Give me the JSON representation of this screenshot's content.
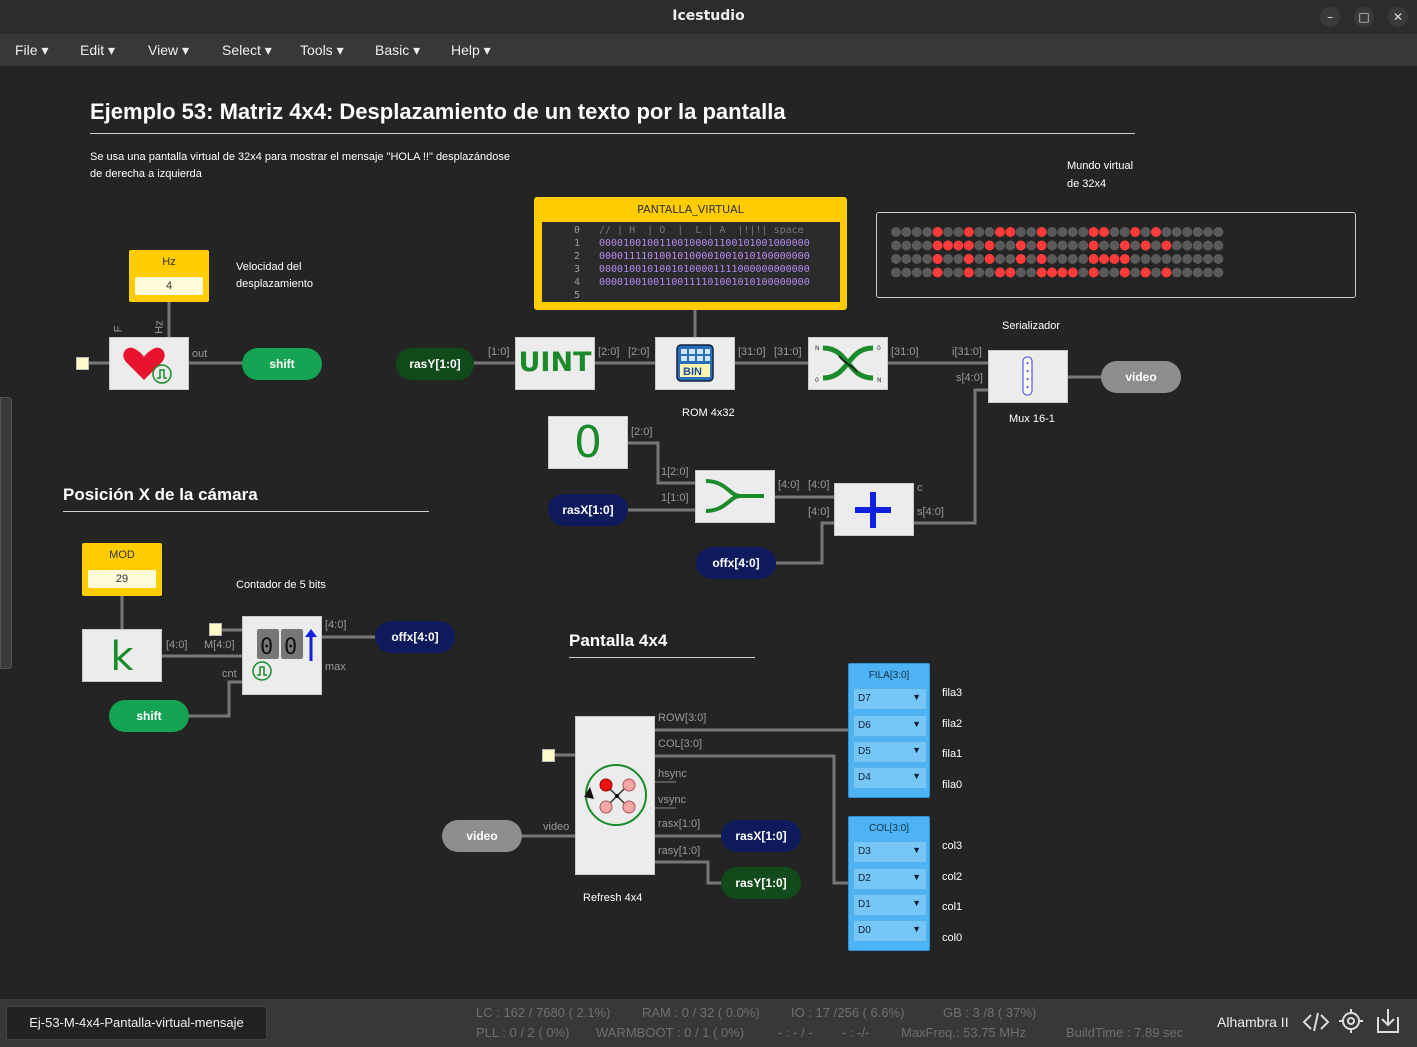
{
  "window": {
    "title": "Icestudio"
  },
  "menu": [
    "File ▾",
    "Edit ▾",
    "View ▾",
    "Select ▾",
    "Tools ▾",
    "Basic ▾",
    "Help ▾"
  ],
  "canvas": {
    "title": "Ejemplo 53: Matriz 4x4: Desplazamiento de un texto por la pantalla",
    "desc1": "Se usa una pantalla virtual de 32x4 para mostrar el mensaje \"HOLA !!\" desplazándose",
    "desc2": "de derecha a izquierda",
    "mundo1": "Mundo virtual",
    "mundo2": "de 32x4",
    "vel1": "Velocidad del",
    "vel2": "desplazamiento",
    "hz_label": "Hz",
    "hz_value": "4",
    "heart_in_f": "F",
    "heart_in_hz": "Hz",
    "heart_out": "out",
    "shift1": "shift",
    "rasy1": "rasY[1:0]",
    "uint": "UINT",
    "w_1_0": "[1:0]",
    "w_2_0a": "[2:0]",
    "w_2_0b": "[2:0]",
    "w_31a": "[31:0]",
    "w_31b": "[31:0]",
    "w_31c": "[31:0]",
    "w_i31": "i[31:0]",
    "w_s40": "s[4:0]",
    "rom_label": "ROM 4x32",
    "serial_label": "Serializador",
    "mux_label": "Mux 16-1",
    "video_out": "video",
    "bin": "BIN",
    "zero": "0",
    "w_20c": "[2:0]",
    "w_1_20": "1[2:0]",
    "w_1_10": "1[1:0]",
    "w_40a": "[4:0]",
    "w_40b": "[4:0]",
    "w_40c": "[4:0]",
    "w_c": "c",
    "w_s40b": "s[4:0]",
    "rasx1": "rasX[1:0]",
    "offx1": "offx[4:0]",
    "posx_title": "Posición X de la cámara",
    "mod_label": "MOD",
    "mod_value": "29",
    "contador": "Contador de 5 bits",
    "k": "k",
    "w_k40": "[4:0]",
    "w_m40": "M[4:0]",
    "w_cnt": "cnt",
    "w_cnt40": "[4:0]",
    "w_max": "max",
    "offx2": "offx[4:0]",
    "shift2": "shift",
    "p44_title": "Pantalla 4x4",
    "row30": "ROW[3:0]",
    "col30": "COL[3:0]",
    "hsync": "hsync",
    "vsync": "vsync",
    "rasx_w": "rasx[1:0]",
    "rasy_w": "rasy[1:0]",
    "video_w": "video",
    "video_in": "video",
    "rasx2": "rasX[1:0]",
    "rasy2": "rasY[1:0]",
    "refresh": "Refresh 4x4",
    "fila": {
      "title": "FILA[3:0]",
      "opts": [
        "D7",
        "D6",
        "D5",
        "D4"
      ],
      "outs": [
        "fila3",
        "fila2",
        "fila1",
        "fila0"
      ]
    },
    "col": {
      "title": "COL[3:0]",
      "opts": [
        "D3",
        "D2",
        "D1",
        "D0"
      ],
      "outs": [
        "col3",
        "col2",
        "col1",
        "col0"
      ]
    },
    "rom": {
      "title": "PANTALLA_VIRTUAL",
      "lines": [
        {
          "n": "0",
          "t": "// | H  | O  |  L | A  |!|!| space",
          "comment": true
        },
        {
          "n": "1",
          "t": "00001001001100100001100101001000000"
        },
        {
          "n": "2",
          "t": "00001111010010100001001010100000000"
        },
        {
          "n": "3",
          "t": "00001001010010100001111000000000000"
        },
        {
          "n": "4",
          "t": "00001001001100111101001010100000000"
        },
        {
          "n": "5",
          "t": ""
        }
      ]
    }
  },
  "led_rows": [
    "00001001001100100001100101000000",
    "00001111010010100001001010100000",
    "00001001010010100001111000000000",
    "00001001001100111101001010100000"
  ],
  "colors": {
    "led_on": "#ff3b3b",
    "led_off": "#5a5a5a",
    "accent_yellow": "#ffcc00",
    "panel_blue": "#4db3f5"
  },
  "statusbar": {
    "file": "Ej-53-M-4x4-Pantalla-virtual-mensaje",
    "lc": "LC : 162 / 7680 ( 2.1%)",
    "ram": "RAM : 0 / 32 ( 0.0%)",
    "io": "IO : 17 /256 ( 6.6%)",
    "gb": "GB : 3 /8 ( 37%)",
    "pll": "PLL : 0 / 2 ( 0%)",
    "warm": "WARMBOOT : 0 / 1 ( 0%)",
    "dash1": "- : - / -",
    "dash2": "- : -/-",
    "maxf": "MaxFreq.: 53.75 MHz",
    "build": "BuildTime : 7.89 sec",
    "board": "Alhambra II"
  }
}
